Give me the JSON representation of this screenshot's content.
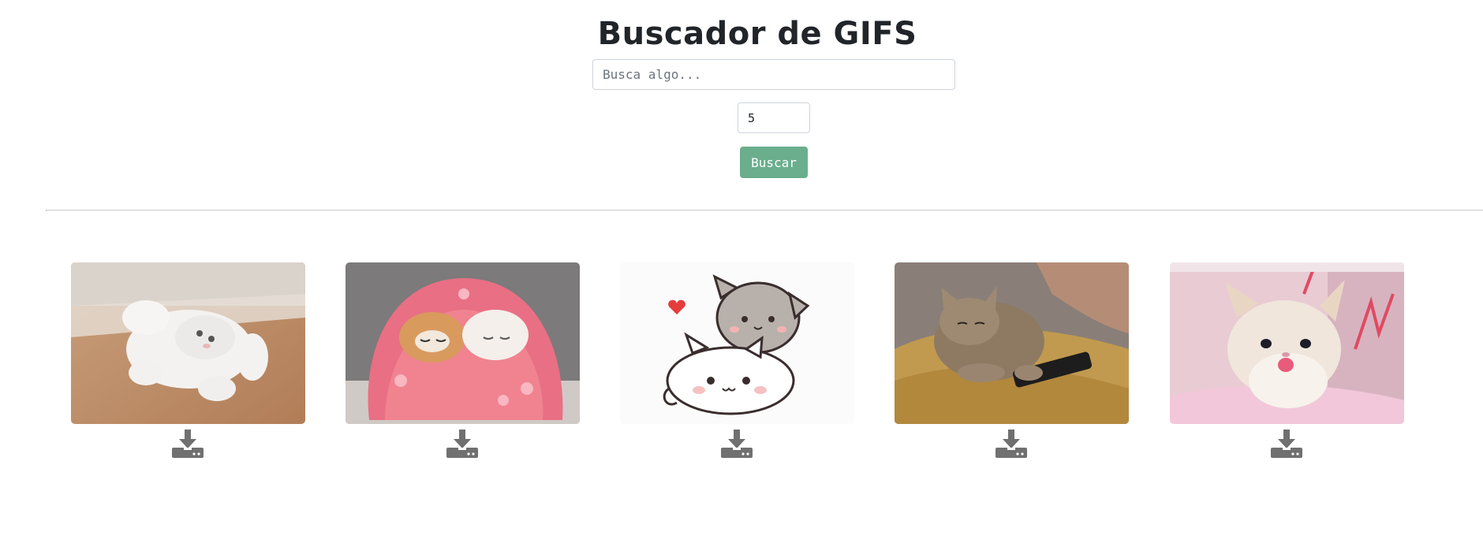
{
  "header": {
    "title": "Buscador de GIFS"
  },
  "search": {
    "placeholder": "Busca algo...",
    "value": ""
  },
  "limit": {
    "value": "5"
  },
  "search_button": {
    "label": "Buscar"
  },
  "results": [
    {
      "image_name": "white-kitten-rolling-gif",
      "download_icon": "download-icon"
    },
    {
      "image_name": "kittens-in-pink-blanket-gif",
      "download_icon": "download-icon"
    },
    {
      "image_name": "cartoon-cats-hugging-gif",
      "download_icon": "download-icon"
    },
    {
      "image_name": "tabby-cat-with-phone-gif",
      "download_icon": "download-icon"
    },
    {
      "image_name": "meowing-kitten-gif",
      "download_icon": "download-icon"
    }
  ],
  "colors": {
    "button": "#6aae8d",
    "divider": "#d3d3d3",
    "download_icon": "#707070",
    "title": "#212529"
  }
}
